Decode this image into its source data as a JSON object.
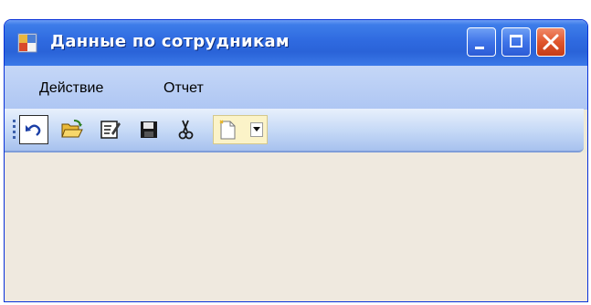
{
  "window": {
    "title": "Данные по сотрудникам",
    "icon": "form-app-icon",
    "controls": [
      "minimize-icon",
      "maximize-icon",
      "close-icon"
    ]
  },
  "menu": {
    "items": [
      {
        "label": "Действие"
      },
      {
        "label": "Отчет"
      }
    ]
  },
  "toolbar": {
    "buttons": [
      {
        "icon": "undo-icon"
      },
      {
        "icon": "open-folder-icon"
      },
      {
        "icon": "edit-icon"
      },
      {
        "icon": "save-icon"
      },
      {
        "icon": "cut-icon"
      },
      {
        "icon": "new-document-icon",
        "dropdown": true
      }
    ]
  },
  "colors": {
    "titlebar": "#2f6ae0",
    "menubar": "#c5d7f7",
    "client_area": "#efe9df",
    "close_button": "#e0562d"
  }
}
